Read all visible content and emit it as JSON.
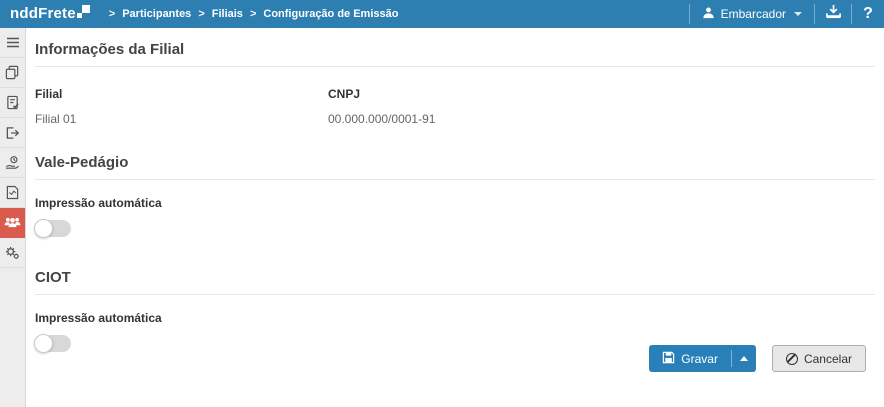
{
  "topbar": {
    "logo": "nddFrete",
    "breadcrumb": [
      "Participantes",
      "Filiais",
      "Configuração de Emissão"
    ],
    "user_label": "Embarcador",
    "help_label": "?",
    "icons": [
      "user-icon",
      "chevron-down-icon",
      "download-icon",
      "help-icon"
    ]
  },
  "sidebar": {
    "items": [
      {
        "icon": "menu-icon",
        "active": false
      },
      {
        "icon": "copy-icon",
        "active": false
      },
      {
        "icon": "clipboard-check-icon",
        "active": false
      },
      {
        "icon": "exit-icon",
        "active": false
      },
      {
        "icon": "hand-coin-icon",
        "active": false
      },
      {
        "icon": "report-icon",
        "active": false
      },
      {
        "icon": "participants-icon",
        "active": true
      },
      {
        "icon": "settings-gears-icon",
        "active": false
      }
    ],
    "active_color": "#d95b4d"
  },
  "main": {
    "sections": [
      {
        "title": "Informações da Filial",
        "fields": [
          {
            "label": "Filial",
            "value": "Filial 01"
          },
          {
            "label": "CNPJ",
            "value": "00.000.000/0001-91"
          }
        ]
      },
      {
        "title": "Vale-Pedágio",
        "toggle_label": "Impressão automática",
        "toggle_state": "off"
      },
      {
        "title": "CIOT",
        "toggle_label": "Impressão automática",
        "toggle_state": "off"
      }
    ],
    "actions": {
      "save_label": "Gravar",
      "cancel_label": "Cancelar"
    }
  },
  "colors": {
    "topbar": "#2d7eb1",
    "sidebar_active": "#d95b4d",
    "primary_button": "#2980b9"
  }
}
